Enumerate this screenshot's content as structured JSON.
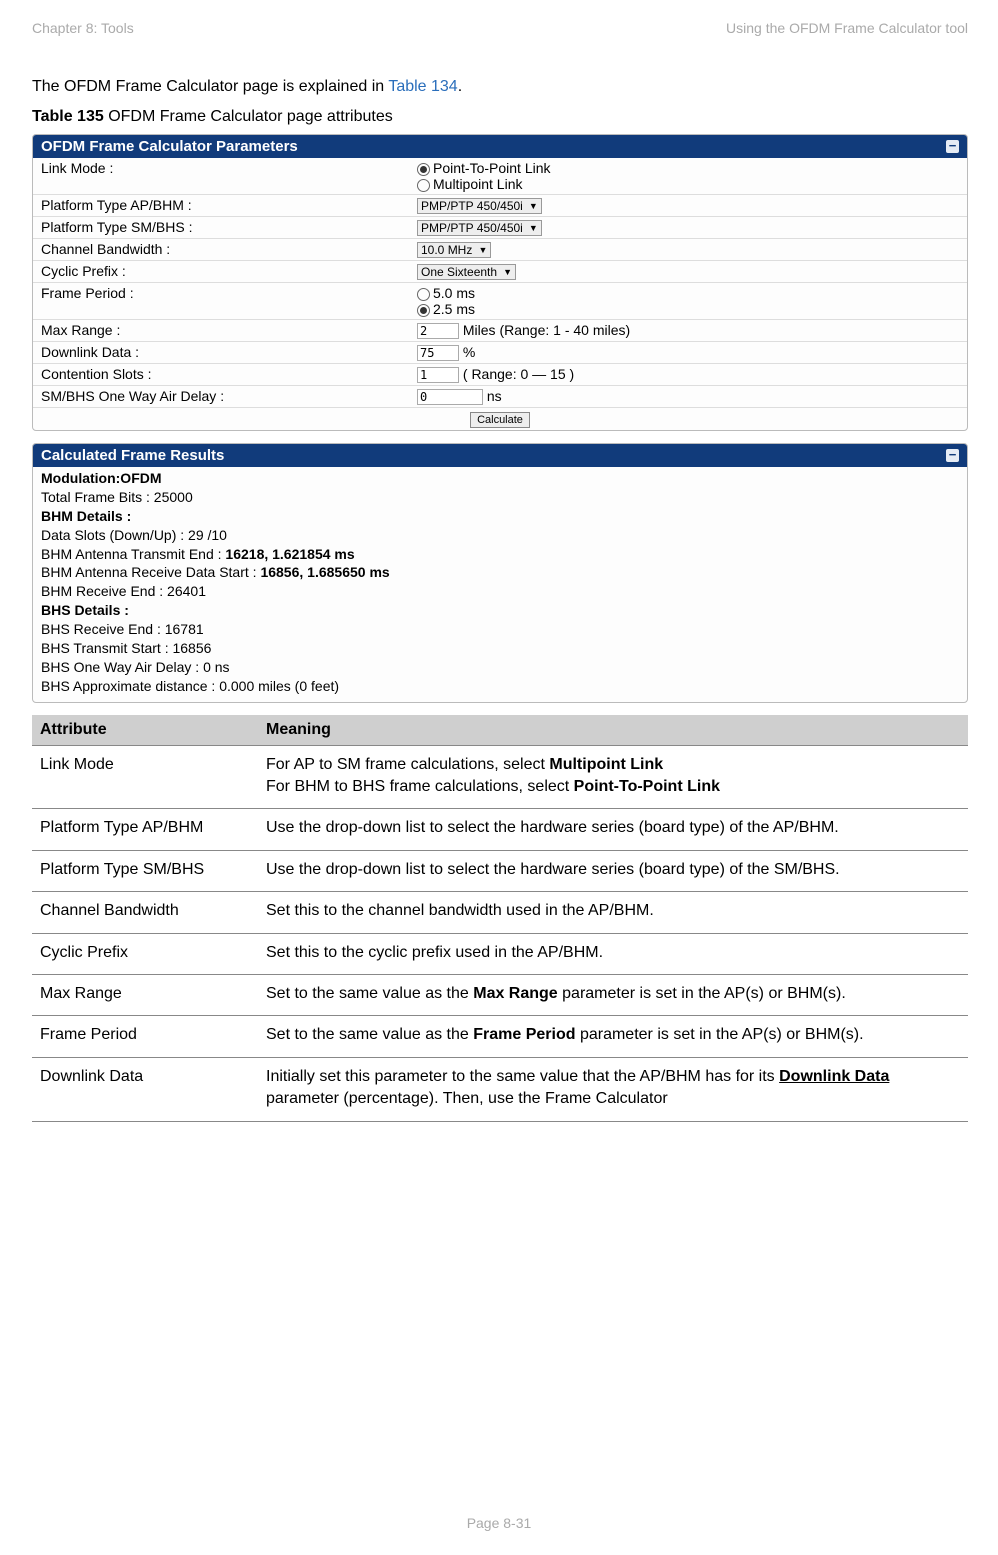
{
  "header": {
    "left": "Chapter 8:  Tools",
    "right": "Using the OFDM Frame Calculator tool"
  },
  "intro": {
    "prefix": "The OFDM Frame Calculator page is explained in ",
    "link": "Table 134",
    "suffix": "."
  },
  "caption": {
    "label": "Table 135",
    "text": "  OFDM Frame Calculator page attributes"
  },
  "params": {
    "title": "OFDM Frame Calculator Parameters",
    "link_mode": {
      "label": "Link Mode :",
      "opt1": "Point-To-Point Link",
      "opt2": "Multipoint Link"
    },
    "ptype_ap": {
      "label": "Platform Type AP/BHM :",
      "value": "PMP/PTP 450/450i"
    },
    "ptype_sm": {
      "label": "Platform Type SM/BHS :",
      "value": "PMP/PTP 450/450i"
    },
    "bw": {
      "label": "Channel Bandwidth :",
      "value": "10.0 MHz"
    },
    "cp": {
      "label": "Cyclic Prefix :",
      "value": "One Sixteenth"
    },
    "fp": {
      "label": "Frame Period :",
      "opt1": "5.0 ms",
      "opt2": "2.5 ms"
    },
    "range": {
      "label": "Max Range :",
      "value": "2",
      "suffix": " Miles (Range: 1 - 40 miles)"
    },
    "dl": {
      "label": "Downlink Data :",
      "value": "75",
      "suffix": " %"
    },
    "cs": {
      "label": "Contention Slots :",
      "value": "1",
      "suffix": " ( Range: 0 — 15 )"
    },
    "delay": {
      "label": "SM/BHS One Way Air Delay :",
      "value": "0",
      "suffix": " ns"
    },
    "calc": "Calculate"
  },
  "results": {
    "title": "Calculated Frame Results",
    "l0": "Modulation:OFDM",
    "l1": "Total Frame Bits : 25000",
    "l2": "BHM Details :",
    "l3": "Data Slots (Down/Up) : 29 /10",
    "l4a": "BHM Antenna Transmit End : ",
    "l4b": "16218, 1.621854 ms",
    "l5a": "BHM Antenna Receive Data Start : ",
    "l5b": "16856, 1.685650 ms",
    "l6": "BHM Receive End : 26401",
    "l7": "BHS Details :",
    "l8": "BHS Receive End : 16781",
    "l9": "BHS Transmit Start : 16856",
    "l10": "BHS One Way Air Delay : 0 ns",
    "l11": "BHS Approximate distance : 0.000 miles (0 feet)"
  },
  "table": {
    "h1": "Attribute",
    "h2": "Meaning",
    "rows": [
      {
        "attr": "Link Mode",
        "m1": "For AP to SM frame calculations, select ",
        "m1b": "Multipoint Link",
        "m2": "For BHM to BHS frame calculations, select ",
        "m2b": "Point-To-Point Link"
      },
      {
        "attr": "Platform Type AP/BHM",
        "m": "Use the drop-down list to select the hardware series (board type) of the AP/BHM."
      },
      {
        "attr": "Platform Type SM/BHS",
        "m": "Use the drop-down list to select the hardware series (board type) of the SM/BHS."
      },
      {
        "attr": "Channel Bandwidth",
        "m": "Set this to the channel bandwidth used in the AP/BHM."
      },
      {
        "attr": "Cyclic Prefix",
        "m": "Set this to the cyclic prefix used in the AP/BHM."
      },
      {
        "attr": "Max Range",
        "m1": "Set to the same value as the ",
        "mb": "Max Range",
        "m2": " parameter is set in the AP(s) or BHM(s)."
      },
      {
        "attr": "Frame Period",
        "m1": "Set to the same value as the ",
        "mb": "Frame Period",
        "m2": " parameter is set in the AP(s) or BHM(s)."
      },
      {
        "attr": "Downlink Data",
        "m1": "Initially set this parameter to the same value that the AP/BHM has for its ",
        "mb": "Downlink Data",
        "m2": " parameter (percentage). Then, use the Frame Calculator"
      }
    ]
  },
  "footer": "Page 8-31"
}
